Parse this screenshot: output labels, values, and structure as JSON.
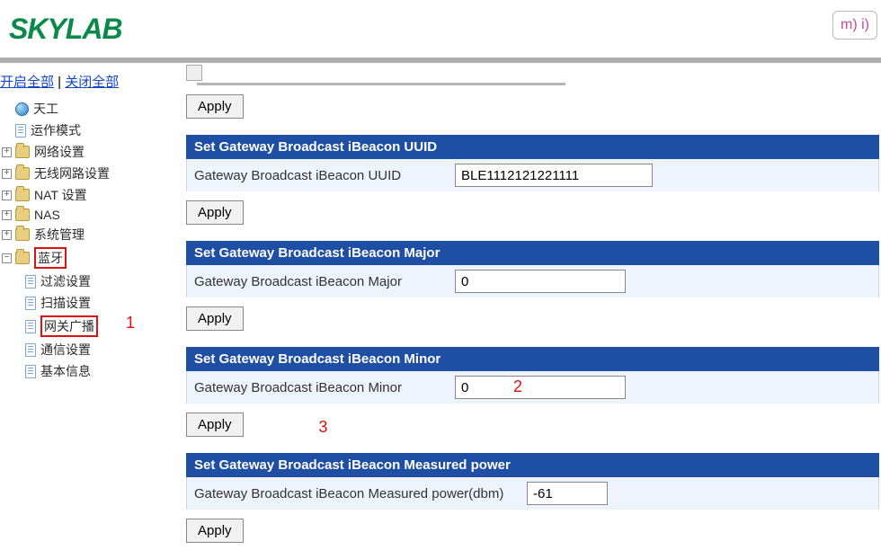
{
  "logo": "SKYLAB",
  "top_badge": "m) i)",
  "toggle": {
    "open_all": "开启全部",
    "close_all": "关闭全部",
    "sep": " | "
  },
  "tree": {
    "root": "天工",
    "items": [
      "运作模式",
      "网络设置",
      "无线网路设置",
      "NAT 设置",
      "NAS",
      "系统管理",
      "蓝牙"
    ],
    "bt_children": [
      "过滤设置",
      "扫描设置",
      "网关广播",
      "通信设置",
      "基本信息"
    ]
  },
  "annotations": {
    "a1": "1",
    "a2": "2",
    "a3": "3"
  },
  "apply_label": "Apply",
  "sections": {
    "uuid": {
      "header": "Set Gateway Broadcast iBeacon UUID",
      "label": "Gateway Broadcast iBeacon UUID",
      "value": "BLE1112121221111"
    },
    "major": {
      "header": "Set Gateway Broadcast iBeacon Major",
      "label": "Gateway Broadcast iBeacon Major",
      "value": "0"
    },
    "minor": {
      "header": "Set Gateway Broadcast iBeacon Minor",
      "label": "Gateway Broadcast iBeacon Minor",
      "value": "0"
    },
    "power": {
      "header": "Set Gateway Broadcast iBeacon Measured power",
      "label": "Gateway Broadcast iBeacon Measured power(dbm)",
      "value": "-61"
    }
  }
}
